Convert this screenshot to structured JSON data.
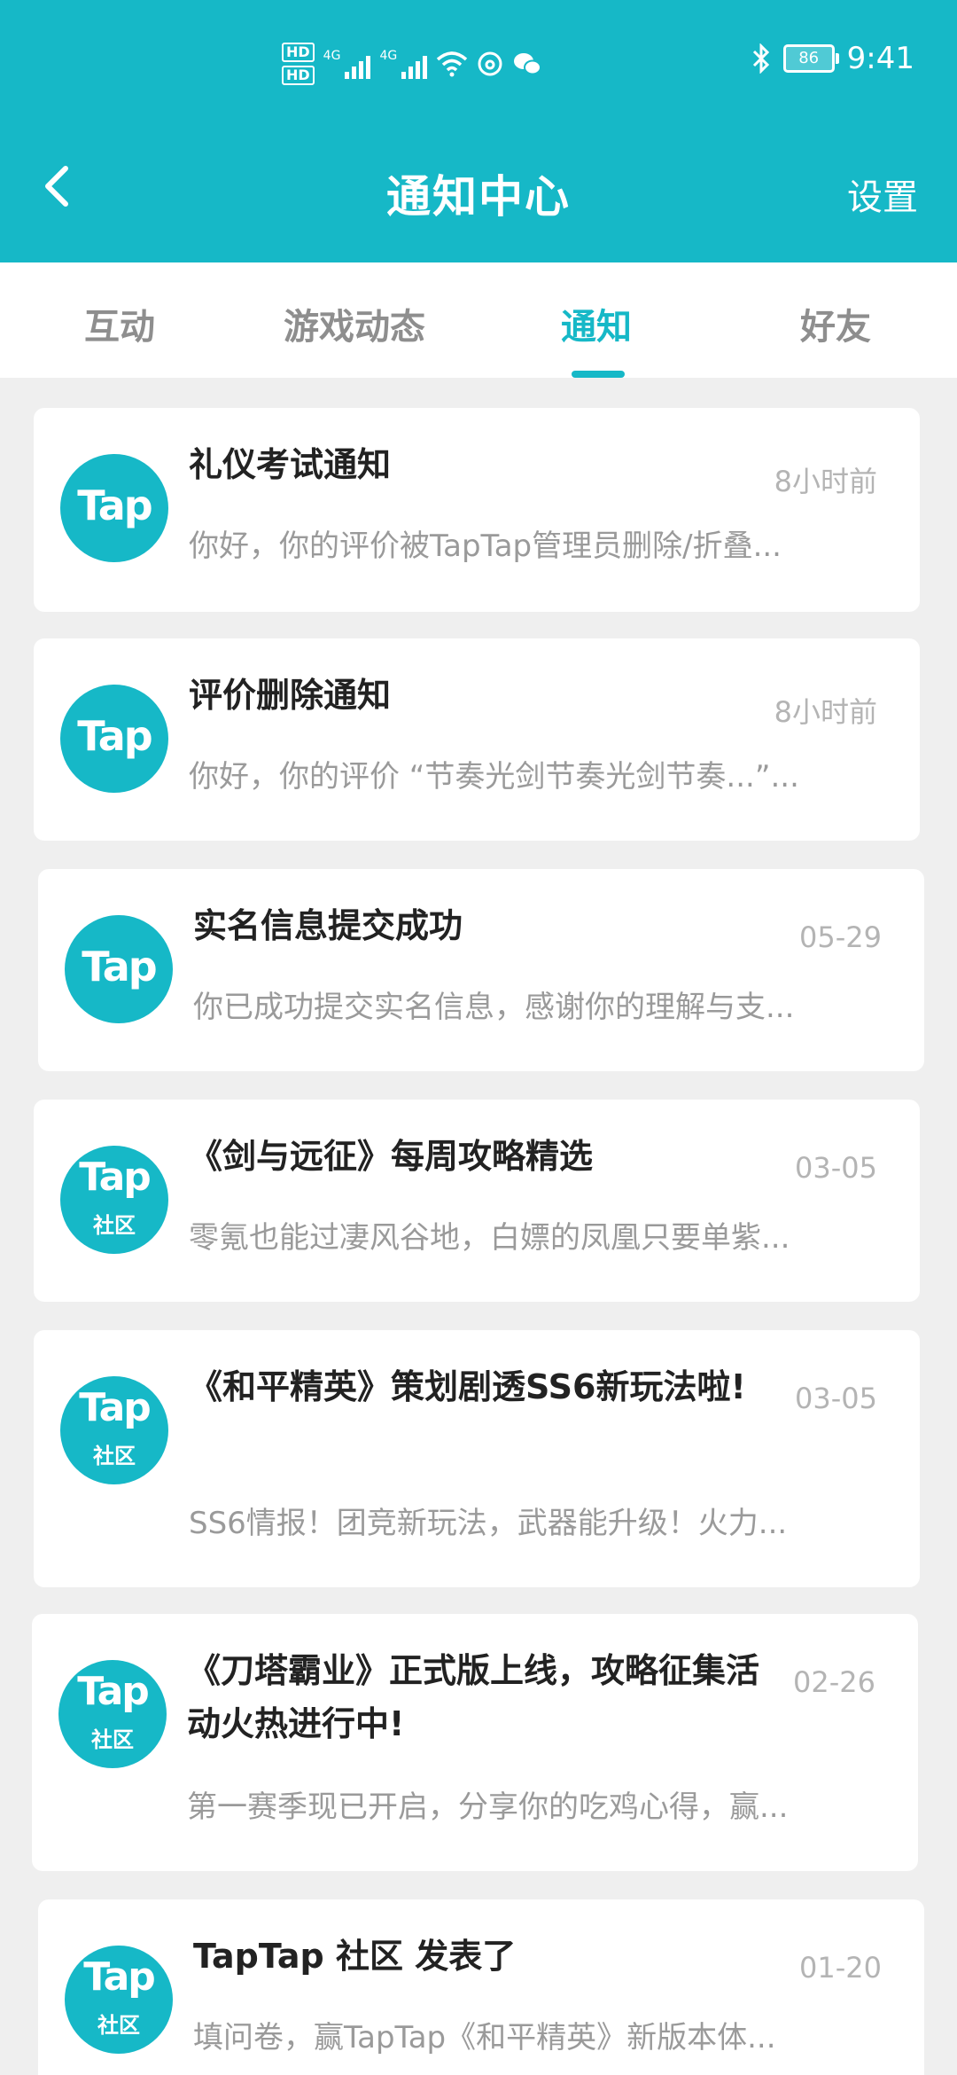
{
  "status_bar": {
    "hd1": "HD",
    "hd2": "HD",
    "net1": "4G",
    "net2": "4G",
    "battery": "86",
    "time": "9:41"
  },
  "header": {
    "title": "通知中心",
    "settings_label": "设置"
  },
  "tabs": [
    {
      "label": "互动"
    },
    {
      "label": "游戏动态"
    },
    {
      "label": "通知"
    },
    {
      "label": "好友"
    }
  ],
  "active_tab": "通知",
  "colors": {
    "brand": "#16b8c7",
    "background": "#efefef",
    "title_text": "#222222",
    "muted_text": "#9a9a9a"
  },
  "notifications": [
    {
      "avatar_text": "Tap",
      "avatar_sub": "",
      "title": "礼仪考试通知",
      "time": "8小时前",
      "preview": "你好，你的评价被TapTap管理员删除/折叠..."
    },
    {
      "avatar_text": "Tap",
      "avatar_sub": "",
      "title": "评价删除通知",
      "time": "8小时前",
      "preview": "你好，你的评价 “节奏光剑节奏光剑节奏...”..."
    },
    {
      "avatar_text": "Tap",
      "avatar_sub": "",
      "title": "实名信息提交成功",
      "time": "05-29",
      "preview": "你已成功提交实名信息，感谢你的理解与支..."
    },
    {
      "avatar_text": "Tap",
      "avatar_sub": "社区",
      "title": "《剑与远征》每周攻略精选",
      "time": "03-05",
      "preview": "零氪也能过凄风谷地，白嫖的凤凰只要单紫..."
    },
    {
      "avatar_text": "Tap",
      "avatar_sub": "社区",
      "title": "《和平精英》策划剧透SS6新玩法啦!",
      "time": "03-05",
      "preview": "SS6情报！团竞新玩法，武器能升级！火力..."
    },
    {
      "avatar_text": "Tap",
      "avatar_sub": "社区",
      "title": "《刀塔霸业》正式版上线，攻略征集活动火热进行中!",
      "time": "02-26",
      "preview": "第一赛季现已开启，分享你的吃鸡心得，赢..."
    },
    {
      "avatar_text": "Tap",
      "avatar_sub": "社区",
      "title": "TapTap 社区 发表了",
      "time": "01-20",
      "preview": "填问卷，赢TapTap《和平精英》新版本体..."
    }
  ]
}
